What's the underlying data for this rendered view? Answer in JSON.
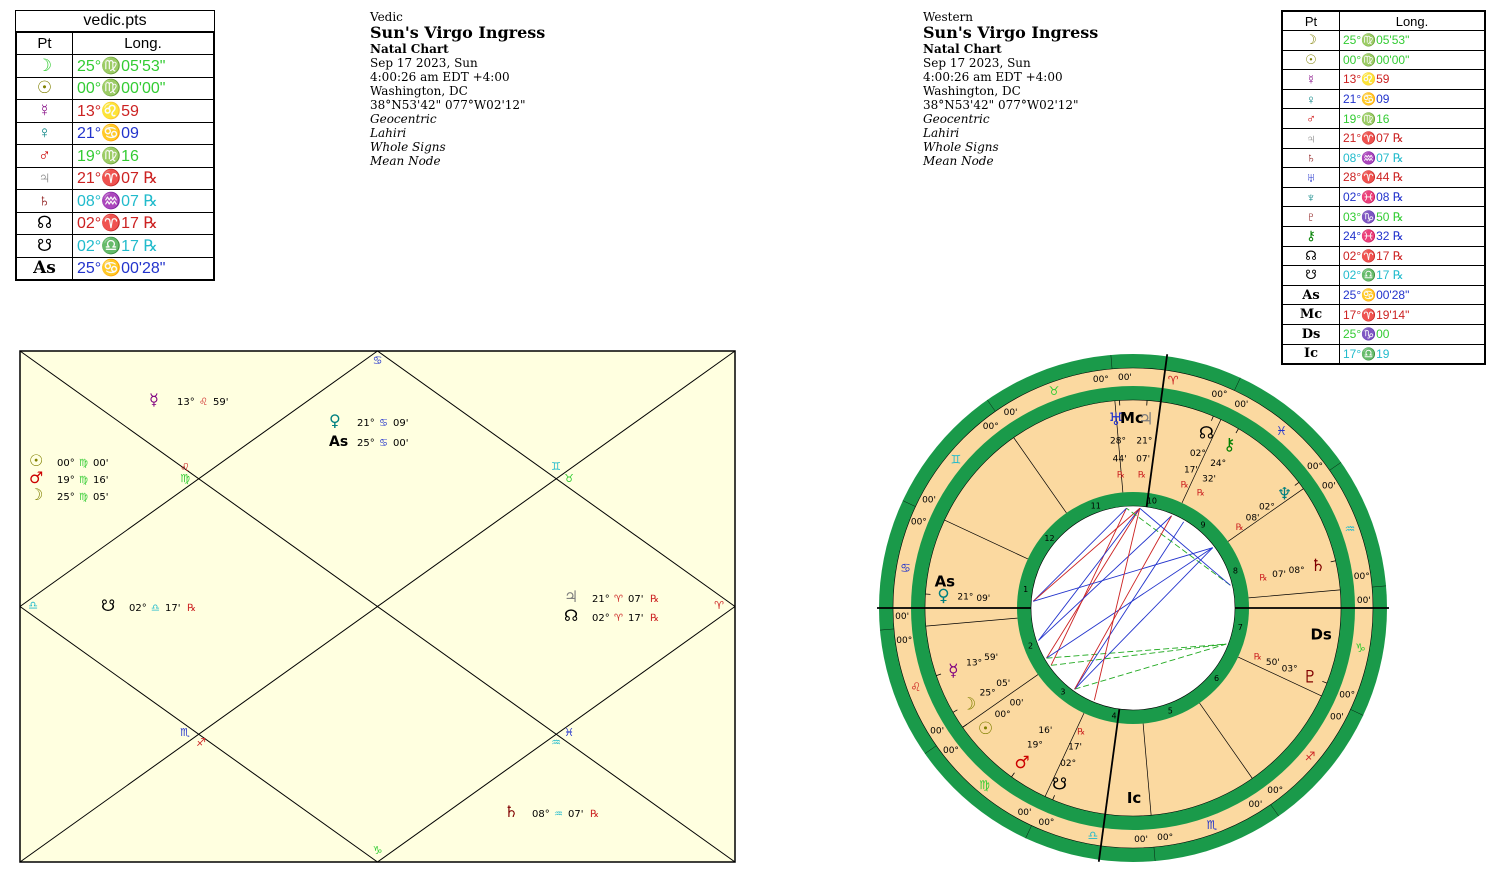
{
  "vedic_table": {
    "title": "vedic.pts",
    "headers": [
      "Pt",
      "Long."
    ],
    "rows": [
      {
        "icon": "moon-icon",
        "glyph": "☽",
        "value": "25°♍05'53\"",
        "color": "#33cc33"
      },
      {
        "icon": "sun-icon",
        "glyph": "☉",
        "value": "00°♍00'00\"",
        "color": "#33cc33",
        "gcolor": "#808000"
      },
      {
        "icon": "mercury-icon",
        "glyph": "☿",
        "value": "13°♌59",
        "color": "#cc2222",
        "gcolor": "#800080"
      },
      {
        "icon": "venus-icon",
        "glyph": "♀",
        "value": "21°♋09",
        "color": "#2233cc",
        "gcolor": "#008080"
      },
      {
        "icon": "mars-icon",
        "glyph": "♂",
        "value": "19°♍16",
        "color": "#33cc33",
        "gcolor": "#cc0000"
      },
      {
        "icon": "jupiter-icon",
        "glyph": "♃",
        "value": "21°♈07 ℞",
        "color": "#cc2222",
        "gcolor": "#808080"
      },
      {
        "icon": "saturn-icon",
        "glyph": "♄",
        "value": "08°♒07 ℞",
        "color": "#22bbcc",
        "gcolor": "#800000"
      },
      {
        "icon": "north-node-icon",
        "glyph": "☊",
        "value": "02°♈17 ℞",
        "color": "#cc2222",
        "gcolor": "#000000"
      },
      {
        "icon": "south-node-icon",
        "glyph": "☋",
        "value": "02°♎17 ℞",
        "color": "#22bbcc",
        "gcolor": "#000000"
      },
      {
        "icon": "ascendant-icon",
        "glyph": "As",
        "value": "25°♋00'28\"",
        "color": "#2233cc",
        "gcolor": "#000000"
      }
    ]
  },
  "vedic_info": {
    "label": "Vedic",
    "title": "Sun's Virgo Ingress",
    "chart_type": "Natal Chart",
    "date": "Sep 17 2023, Sun",
    "time": "4:00:26 am  EDT +4:00",
    "place": "Washington, DC",
    "coords": "38°N53'42\" 077°W02'12\"",
    "opt1": "Geocentric",
    "opt2": "Lahiri",
    "opt3": "Whole Signs",
    "opt4": "Mean Node"
  },
  "west_info": {
    "label": "Western",
    "title": "Sun's Virgo Ingress",
    "chart_type": "Natal Chart",
    "date": "Sep 17 2023, Sun",
    "time": "4:00:26 am  EDT +4:00",
    "place": "Washington, DC",
    "coords": "38°N53'42\" 077°W02'12\"",
    "opt1": "Geocentric",
    "opt2": "Lahiri",
    "opt3": "Whole Signs",
    "opt4": "Mean Node"
  },
  "west_table": {
    "headers": [
      "Pt",
      "Long."
    ],
    "rows": [
      {
        "icon": "moon-icon",
        "glyph": "☽",
        "value": "25°♍05'53\"",
        "color": "#33cc33",
        "gcolor": "#808000"
      },
      {
        "icon": "sun-icon",
        "glyph": "☉",
        "value": "00°♍00'00\"",
        "color": "#33cc33",
        "gcolor": "#808000"
      },
      {
        "icon": "mercury-icon",
        "glyph": "☿",
        "value": "13°♌59",
        "color": "#cc2222",
        "gcolor": "#800080"
      },
      {
        "icon": "venus-icon",
        "glyph": "♀",
        "value": "21°♋09",
        "color": "#2233cc",
        "gcolor": "#008080"
      },
      {
        "icon": "mars-icon",
        "glyph": "♂",
        "value": "19°♍16",
        "color": "#33cc33",
        "gcolor": "#cc0000"
      },
      {
        "icon": "jupiter-icon",
        "glyph": "♃",
        "value": "21°♈07 ℞",
        "color": "#cc2222",
        "gcolor": "#808080"
      },
      {
        "icon": "saturn-icon",
        "glyph": "♄",
        "value": "08°♒07 ℞",
        "color": "#22bbcc",
        "gcolor": "#800000"
      },
      {
        "icon": "uranus-icon",
        "glyph": "♅",
        "value": "28°♈44 ℞",
        "color": "#cc2222",
        "gcolor": "#2233cc"
      },
      {
        "icon": "neptune-icon",
        "glyph": "♆",
        "value": "02°♓08 ℞",
        "color": "#2233cc",
        "gcolor": "#008080"
      },
      {
        "icon": "pluto-icon",
        "glyph": "♇",
        "value": "03°♑50 ℞",
        "color": "#33cc33",
        "gcolor": "#800000"
      },
      {
        "icon": "chiron-icon",
        "glyph": "⚷",
        "value": "24°♓32 ℞",
        "color": "#2233cc",
        "gcolor": "#008000"
      },
      {
        "icon": "north-node-icon",
        "glyph": "☊",
        "value": "02°♈17 ℞",
        "color": "#cc2222",
        "gcolor": "#000000"
      },
      {
        "icon": "south-node-icon",
        "glyph": "☋",
        "value": "02°♎17 ℞",
        "color": "#22bbcc",
        "gcolor": "#000000"
      },
      {
        "icon": "ascendant-icon",
        "glyph": "As",
        "value": "25°♋00'28\"",
        "color": "#2233cc",
        "gcolor": "#000000"
      },
      {
        "icon": "midheaven-icon",
        "glyph": "Mc",
        "value": "17°♈19'14\"",
        "color": "#cc2222",
        "gcolor": "#000000"
      },
      {
        "icon": "descendant-icon",
        "glyph": "Ds",
        "value": "25°♑00",
        "color": "#33cc33",
        "gcolor": "#000000"
      },
      {
        "icon": "ic-icon",
        "glyph": "Ic",
        "value": "17°♎19",
        "color": "#22bbcc",
        "gcolor": "#000000"
      }
    ]
  },
  "north_chart": {
    "background": "#ffffe0",
    "signs": [
      {
        "g": "♋",
        "c": "#2233cc",
        "name": "cancer"
      },
      {
        "g": "♌",
        "c": "#cc2222",
        "name": "leo"
      },
      {
        "g": "♍",
        "c": "#33cc33",
        "name": "virgo"
      },
      {
        "g": "♎",
        "c": "#22bbcc",
        "name": "libra"
      },
      {
        "g": "♏",
        "c": "#2233cc",
        "name": "scorpio"
      },
      {
        "g": "♐",
        "c": "#cc2222",
        "name": "sagittarius"
      },
      {
        "g": "♑",
        "c": "#33cc33",
        "name": "capricorn"
      },
      {
        "g": "♒",
        "c": "#22bbcc",
        "name": "aquarius"
      },
      {
        "g": "♓",
        "c": "#2233cc",
        "name": "pisces"
      },
      {
        "g": "♈",
        "c": "#cc2222",
        "name": "aries"
      },
      {
        "g": "♉",
        "c": "#33cc33",
        "name": "taurus"
      },
      {
        "g": "♊",
        "c": "#22bbcc",
        "name": "gemini"
      }
    ],
    "planets": [
      {
        "name": "mercury",
        "g": "☿",
        "gc": "#800080",
        "deg": "13°",
        "s": "♌",
        "sc": "#cc2222",
        "min": "59'",
        "rx": ""
      },
      {
        "name": "venus",
        "g": "♀",
        "gc": "#008080",
        "deg": "21°",
        "s": "♋",
        "sc": "#2233cc",
        "min": "09'",
        "rx": ""
      },
      {
        "name": "ascendant",
        "g": "As",
        "gc": "#000000",
        "deg": "25°",
        "s": "♋",
        "sc": "#2233cc",
        "min": "00'",
        "rx": ""
      },
      {
        "name": "sun",
        "g": "☉",
        "gc": "#808000",
        "deg": "00°",
        "s": "♍",
        "sc": "#33cc33",
        "min": "00'",
        "rx": ""
      },
      {
        "name": "mars",
        "g": "♂",
        "gc": "#cc0000",
        "deg": "19°",
        "s": "♍",
        "sc": "#33cc33",
        "min": "16'",
        "rx": ""
      },
      {
        "name": "moon",
        "g": "☽",
        "gc": "#808000",
        "deg": "25°",
        "s": "♍",
        "sc": "#33cc33",
        "min": "05'",
        "rx": ""
      },
      {
        "name": "south-node",
        "g": "☋",
        "gc": "#000000",
        "deg": "02°",
        "s": "♎",
        "sc": "#22bbcc",
        "min": "17'",
        "rx": "℞"
      },
      {
        "name": "jupiter",
        "g": "♃",
        "gc": "#808080",
        "deg": "21°",
        "s": "♈",
        "sc": "#cc2222",
        "min": "07'",
        "rx": "℞"
      },
      {
        "name": "north-node",
        "g": "☊",
        "gc": "#000000",
        "deg": "02°",
        "s": "♈",
        "sc": "#cc2222",
        "min": "17'",
        "rx": "℞"
      },
      {
        "name": "saturn",
        "g": "♄",
        "gc": "#800000",
        "deg": "08°",
        "s": "♒",
        "sc": "#22bbcc",
        "min": "07'",
        "rx": "℞"
      }
    ]
  },
  "wheel": {
    "ring_color": "#1a9a4a",
    "house_color": "#fbd9a0",
    "ascendant_longitude": 115.0,
    "midheaven_longitude": 17.32,
    "cusp_labels": [
      "00°",
      "00'"
    ],
    "houses": [
      "1",
      "2",
      "3",
      "4",
      "5",
      "6",
      "7",
      "8",
      "9",
      "10",
      "11",
      "12"
    ],
    "signs": [
      {
        "g": "♈",
        "c": "#cc2222"
      },
      {
        "g": "♉",
        "c": "#33cc33"
      },
      {
        "g": "♊",
        "c": "#22bbcc"
      },
      {
        "g": "♋",
        "c": "#2233cc"
      },
      {
        "g": "♌",
        "c": "#cc2222"
      },
      {
        "g": "♍",
        "c": "#33cc33"
      },
      {
        "g": "♎",
        "c": "#22bbcc"
      },
      {
        "g": "♏",
        "c": "#2233cc"
      },
      {
        "g": "♐",
        "c": "#cc2222"
      },
      {
        "g": "♑",
        "c": "#33cc33"
      },
      {
        "g": "♒",
        "c": "#22bbcc"
      },
      {
        "g": "♓",
        "c": "#2233cc"
      }
    ],
    "points": [
      {
        "name": "moon",
        "g": "☽",
        "gc": "#808000",
        "lon": 145.1,
        "deg": "25°",
        "min": "05'",
        "rx": ""
      },
      {
        "name": "sun",
        "g": "☉",
        "gc": "#808000",
        "lon": 150.0,
        "deg": "00°",
        "min": "00'",
        "rx": ""
      },
      {
        "name": "mercury",
        "g": "☿",
        "gc": "#800080",
        "lon": 133.98,
        "deg": "13°",
        "min": "59'",
        "rx": ""
      },
      {
        "name": "venus",
        "g": "♀",
        "gc": "#008080",
        "lon": 111.15,
        "deg": "21°",
        "min": "09'",
        "rx": ""
      },
      {
        "name": "mars",
        "g": "♂",
        "gc": "#cc0000",
        "lon": 169.27,
        "deg": "19°",
        "min": "16'",
        "rx": ""
      },
      {
        "name": "jupiter",
        "g": "♃",
        "gc": "#808080",
        "lon": 21.12,
        "deg": "21°",
        "min": "07'",
        "rx": "℞"
      },
      {
        "name": "saturn",
        "g": "♄",
        "gc": "#800000",
        "lon": 308.12,
        "deg": "08°",
        "min": "07'",
        "rx": "℞"
      },
      {
        "name": "uranus",
        "g": "♅",
        "gc": "#2233cc",
        "lon": 28.73,
        "deg": "28°",
        "min": "44'",
        "rx": "℞"
      },
      {
        "name": "neptune",
        "g": "♆",
        "gc": "#008080",
        "lon": 332.13,
        "deg": "02°",
        "min": "08'",
        "rx": "℞"
      },
      {
        "name": "pluto",
        "g": "♇",
        "gc": "#800000",
        "lon": 273.83,
        "deg": "03°",
        "min": "50'",
        "rx": "℞"
      },
      {
        "name": "chiron",
        "g": "⚷",
        "gc": "#008000",
        "lon": 354.53,
        "deg": "24°",
        "min": "32'",
        "rx": "℞"
      },
      {
        "name": "north-node",
        "g": "☊",
        "gc": "#000000",
        "lon": 2.28,
        "deg": "02°",
        "min": "17'",
        "rx": "℞"
      },
      {
        "name": "south-node",
        "g": "☋",
        "gc": "#000000",
        "lon": 182.28,
        "deg": "02°",
        "min": "17'",
        "rx": "℞"
      }
    ],
    "angles": [
      {
        "name": "ascendant",
        "g": "As",
        "lon": 115.0
      },
      {
        "name": "midheaven",
        "g": "Mc",
        "lon": 17.32
      },
      {
        "name": "descendant",
        "g": "Ds",
        "lon": 295.0
      },
      {
        "name": "ic",
        "g": "Ic",
        "lon": 197.32
      }
    ],
    "aspects": [
      {
        "a": 145.1,
        "b": 21.12,
        "c": "#cc2222"
      },
      {
        "a": 150.0,
        "b": 28.73,
        "c": "#cc2222"
      },
      {
        "a": 133.98,
        "b": 21.12,
        "c": "#2233cc"
      },
      {
        "a": 111.15,
        "b": 28.73,
        "c": "#2233cc"
      },
      {
        "a": 169.27,
        "b": 354.53,
        "c": "#2233cc"
      },
      {
        "a": 145.1,
        "b": 332.13,
        "c": "#2233cc"
      },
      {
        "a": 111.15,
        "b": 21.12,
        "c": "#cc2222"
      },
      {
        "a": 150.0,
        "b": 273.83,
        "c": "#22aa22"
      },
      {
        "a": 145.1,
        "b": 273.83,
        "c": "#22aa22"
      },
      {
        "a": 169.27,
        "b": 273.83,
        "c": "#22aa22"
      },
      {
        "a": 308.12,
        "b": 28.73,
        "c": "#22aa22"
      },
      {
        "a": 133.98,
        "b": 2.28,
        "c": "#2233cc"
      },
      {
        "a": 169.27,
        "b": 332.13,
        "c": "#2233cc"
      },
      {
        "a": 111.15,
        "b": 332.13,
        "c": "#2233cc"
      },
      {
        "a": 21.12,
        "b": 308.12,
        "c": "#2233cc"
      },
      {
        "a": 169.27,
        "b": 2.28,
        "c": "#cc2222"
      },
      {
        "a": 182.28,
        "b": 21.12,
        "c": "#cc2222"
      }
    ]
  }
}
